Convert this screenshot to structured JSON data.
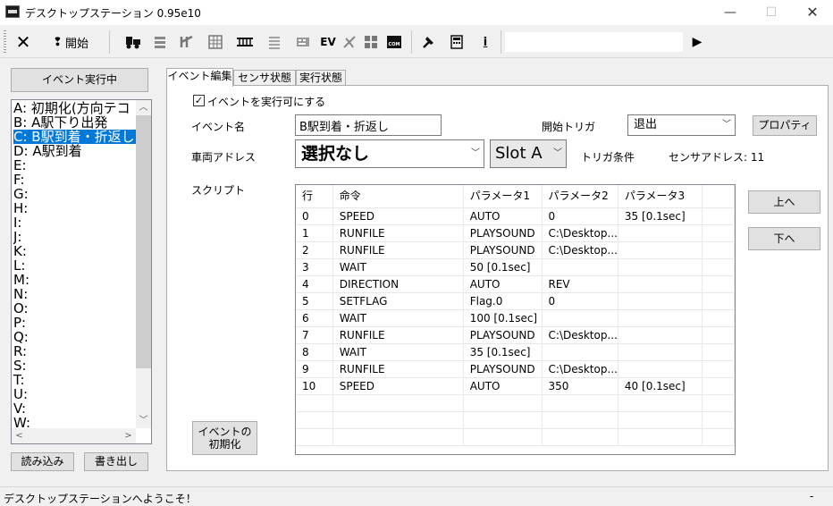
{
  "window": {
    "title": "デスクトップステーション 0.95e10",
    "minimize": "—",
    "maximize": "☐",
    "close": "✕"
  },
  "toolbar": {
    "close_glyph": "✕",
    "start_glyph": "❢",
    "start_label": "開始",
    "ev_label": "EV",
    "icons": [
      "locomotive-icon",
      "stack-icon",
      "turnout-icon",
      "grid-panel-icon",
      "track-icon",
      "list-icon",
      "keyboard-icon",
      "ev-icon",
      "satellite-icon",
      "layout-icon",
      "com-icon",
      "tool-icon",
      "calculator-icon",
      "info-icon",
      "play-icon"
    ],
    "input_value": "",
    "play_glyph": "▶",
    "info_glyph": "i"
  },
  "left": {
    "event_running_label": "イベント実行中",
    "events": [
      "A: 初期化(方向テコ",
      "B: A駅下り出発",
      "C: B駅到着・折返し",
      "D: A駅到着",
      "E:",
      "F:",
      "G:",
      "H:",
      "I:",
      "J:",
      "K:",
      "L:",
      "M:",
      "N:",
      "O:",
      "P:",
      "Q:",
      "R:",
      "S:",
      "T:",
      "U:",
      "V:",
      "W:"
    ],
    "selected_index": 2,
    "load_label": "読み込み",
    "save_label": "書き出し"
  },
  "tabs": [
    "イベント編集",
    "センサ状態",
    "実行状態"
  ],
  "editor": {
    "enable_label": "イベントを実行可にする",
    "enable_checked": "☑",
    "event_name_label": "イベント名",
    "event_name_value": "B駅到着・折返し",
    "start_trigger_label": "開始トリガ",
    "start_trigger_value": "退出",
    "property_label": "プロパティ",
    "vehicle_address_label": "車両アドレス",
    "vehicle_address_value": "選択なし",
    "slot_value": "Slot A",
    "trigger_condition_label": "トリガ条件",
    "sensor_address_label": "センサアドレス: 11",
    "script_label": "スクリプト",
    "init_label_1": "イベントの",
    "init_label_2": "初期化",
    "up_label": "上へ",
    "down_label": "下へ"
  },
  "grid": {
    "columns": [
      "行",
      "命令",
      "パラメータ1",
      "パラメータ2",
      "パラメータ3"
    ],
    "rows": [
      [
        "0",
        "SPEED",
        "AUTO",
        "0",
        "35 [0.1sec]"
      ],
      [
        "1",
        "RUNFILE",
        "PLAYSOUND",
        "C:\\Desktop...",
        ""
      ],
      [
        "2",
        "RUNFILE",
        "PLAYSOUND",
        "C:\\Desktop...",
        ""
      ],
      [
        "3",
        "WAIT",
        "50 [0.1sec]",
        "",
        ""
      ],
      [
        "4",
        "DIRECTION",
        "AUTO",
        "REV",
        ""
      ],
      [
        "5",
        "SETFLAG",
        "Flag.0",
        "0",
        ""
      ],
      [
        "6",
        "WAIT",
        "100 [0.1sec]",
        "",
        ""
      ],
      [
        "7",
        "RUNFILE",
        "PLAYSOUND",
        "C:\\Desktop...",
        ""
      ],
      [
        "8",
        "WAIT",
        "35 [0.1sec]",
        "",
        ""
      ],
      [
        "9",
        "RUNFILE",
        "PLAYSOUND",
        "C:\\Desktop...",
        ""
      ],
      [
        "10",
        "SPEED",
        "AUTO",
        "350",
        "40 [0.1sec]"
      ]
    ]
  },
  "status": {
    "text": "デスクトップステーションへようこそ！",
    "right": "-"
  },
  "colors": {
    "selection": "#0078d7",
    "window_bg": "#f0f0f0"
  }
}
